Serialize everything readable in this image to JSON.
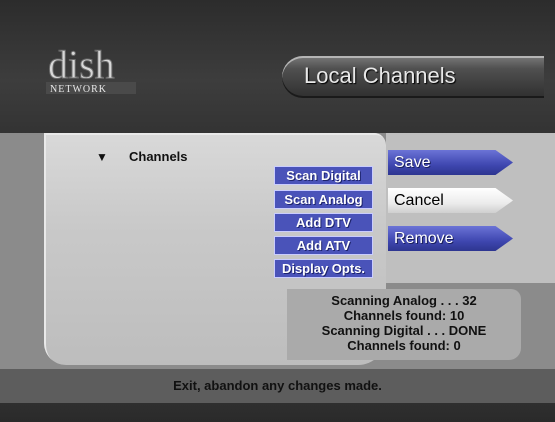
{
  "header": {
    "logo_text": "dish",
    "logo_sub": "NETWORK",
    "title": "Local Channels"
  },
  "tree": {
    "label": "Channels"
  },
  "sub_buttons": [
    "Scan Digital",
    "Scan Analog",
    "Add DTV",
    "Add ATV",
    "Display Opts."
  ],
  "actions": {
    "save": "Save",
    "cancel": "Cancel",
    "remove": "Remove"
  },
  "status": {
    "line1": "Scanning Analog . . . 32",
    "line2": "Channels found: 10",
    "line3": "Scanning Digital . . . DONE",
    "line4": "Channels found: 0"
  },
  "help": "Exit, abandon any changes made.",
  "colors": {
    "button_blue": "#4a53b9",
    "panel_grey": "#c9c9c9",
    "selected_white": "#ffffff"
  }
}
